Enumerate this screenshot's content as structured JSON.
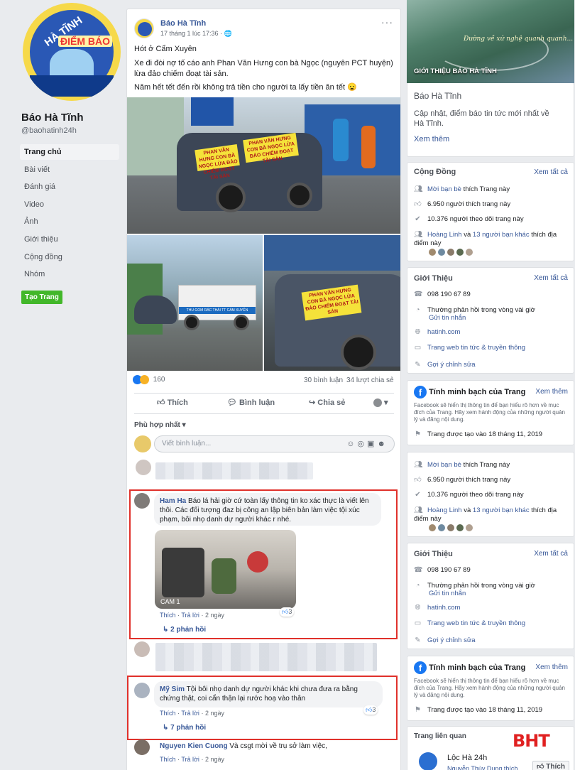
{
  "page": {
    "name": "Báo Hà Tĩnh",
    "handle": "@baohatinh24h",
    "logo_text_top": "HÀ TĨNH",
    "logo_text_band": "ĐIỂM BÁO",
    "nav": [
      "Trang chủ",
      "Bài viết",
      "Đánh giá",
      "Video",
      "Ảnh",
      "Giới thiệu",
      "Cộng đồng",
      "Nhóm"
    ],
    "create_button": "Tạo Trang"
  },
  "post": {
    "author": "Báo Hà Tĩnh",
    "time": "17 tháng 1 lúc 17:36 · ",
    "more": "···",
    "lines": [
      "Hót ở Cẩm Xuyên",
      "Xe đi đòi nợ tố cáo anh Phan Văn Hưng con bà Ngọc (nguyên PCT huyện) lừa đảo chiếm đoạt tài sản.",
      "Năm hết tết đến rồi không trả tiền cho người ta lấy tiền ăn tết 😦"
    ],
    "banner_1": "PHAN VĂN HƯNG CON BÀ NGỌC LỪA ĐẢO CHIẾM ĐOẠT TÀI SẢN",
    "banner_2": "PHAN VĂN HƯNG CON BÀ NGỌC LỪA ĐẢO CHIẾM ĐOẠT TÀI SẢN",
    "truck_text": "THU GOM RÁC THẢI TT CẨM XUYÊN",
    "reaction_count": "160",
    "comments_count": "30 bình luận",
    "shares_count": "34 lượt chia sẻ",
    "actions": {
      "like": "Thích",
      "comment": "Bình luận",
      "share": "Chia sẻ"
    },
    "sort": "Phù hợp nhất ▾",
    "comment_placeholder": "Viết bình luận..."
  },
  "comments": [
    {
      "name": "Ham Ha",
      "text": "Báo lá hải giờ cứ toàn lấy thông tin ko xác thực là viết lên thôi. Các đối tượng đaz bị công an lập biên bản làm việc tội xúc phạm, bôi nhọ danh dự người khác r nhé.",
      "image_caption": "CAM 1",
      "like": "Thích",
      "reply": "Trả lời",
      "time": "2 ngày",
      "likes": "3",
      "replies": "2 phản hồi"
    },
    {
      "name": "Mỹ Sim",
      "text": "Tội bôi nhọ danh dự người khác khi chưa đưa ra bằng chứng thật, coi cẩn thận lại rước hoạ vào thân",
      "like": "Thích",
      "reply": "Trả lời",
      "time": "2 ngày",
      "likes": "3",
      "replies": "7 phản hồi"
    },
    {
      "name": "Nguyen Kien Cuong",
      "text": "Và csgt mời về trụ sở làm việc,",
      "like": "Thích",
      "reply": "Trả lời",
      "time": "2 ngày"
    }
  ],
  "sidebar": {
    "cover_tag": "GIỚI THIỆU BÁO HÀ TĨNH",
    "cover_script": "Đường về xứ nghệ quanh quanh...",
    "about_title": "Báo Hà Tĩnh",
    "about_desc": "Cập nhật, điểm báo tin tức mới nhất về Hà Tĩnh.",
    "see_more": "Xem thêm",
    "community": {
      "title": "Cộng Đồng",
      "see_all": "Xem tất cả",
      "invite_link": "Mời bạn bè",
      "invite_rest": " thích Trang này",
      "likes": "6.950 người thích trang này",
      "follows": "10.376 người theo dõi trang này",
      "friend_a": "Hoàng Linh",
      "friend_mid": " và ",
      "friend_b": "13 người bạn khác",
      "friend_rest": " thích địa điểm này"
    },
    "intro": {
      "title": "Giới Thiệu",
      "see_all": "Xem tất cả",
      "phone": "098 190 67 89",
      "response": "Thường phản hồi trong vòng vài giờ",
      "send_message": "Gửi tin nhắn",
      "website": "hatinh.com",
      "category": "Trang web tin tức & truyền thông",
      "suggest": "Gợi ý chỉnh sửa"
    },
    "transparency": {
      "title": "Tính minh bạch của Trang",
      "see_more": "Xem thêm",
      "desc": "Facebook sẽ hiển thị thông tin để bạn hiểu rõ hơn về mục đích của Trang. Hãy xem hành động của những người quản lý và đăng nội dung.",
      "created": "Trang được tạo vào 18 tháng 11, 2019"
    },
    "related": {
      "title": "Trang liên quan",
      "page_name": "Lộc Hà 24h",
      "page_sub": "Nguyễn Thùy Dung thích",
      "like_button": "Thích"
    },
    "watermark": "BHT"
  }
}
